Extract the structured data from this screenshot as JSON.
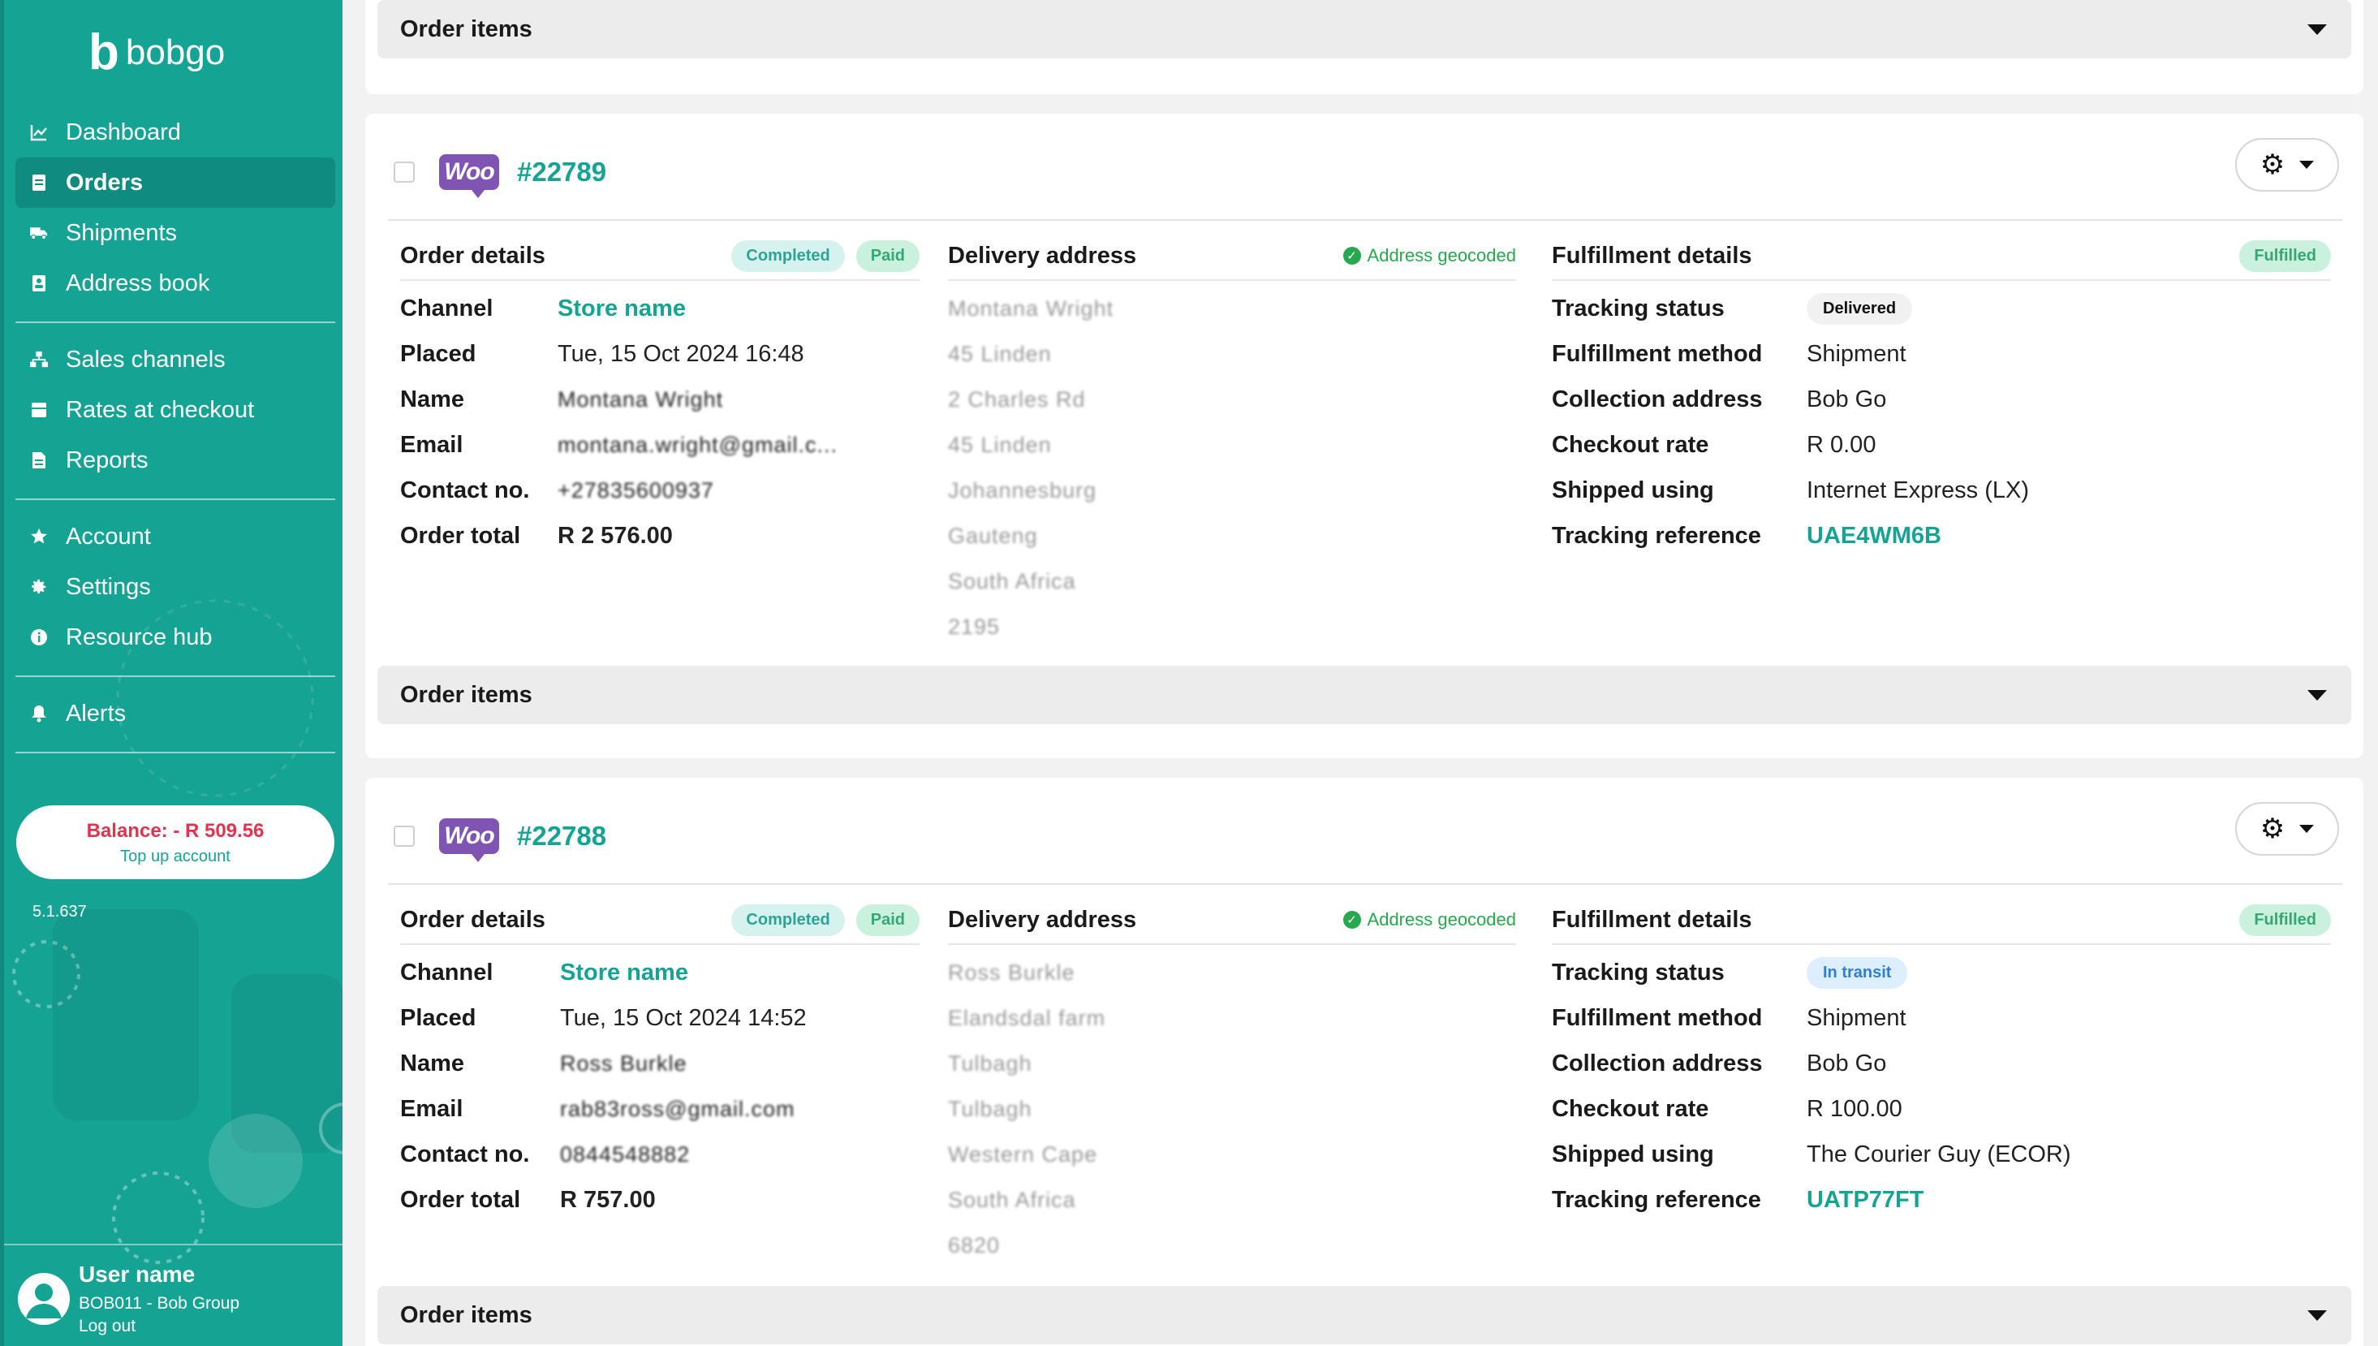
{
  "brand": {
    "logo_mark": "b",
    "logo_text": "bobgo"
  },
  "sidebar": {
    "nav_group1": [
      {
        "label": "Dashboard",
        "icon": "chart-line-icon",
        "active": false
      },
      {
        "label": "Orders",
        "icon": "document-icon",
        "active": true
      },
      {
        "label": "Shipments",
        "icon": "truck-icon",
        "active": false
      },
      {
        "label": "Address book",
        "icon": "address-book-icon",
        "active": false
      }
    ],
    "nav_group2": [
      {
        "label": "Sales channels",
        "icon": "sitemap-icon",
        "active": false
      },
      {
        "label": "Rates at checkout",
        "icon": "cart-icon",
        "active": false
      },
      {
        "label": "Reports",
        "icon": "report-icon",
        "active": false
      }
    ],
    "nav_group3": [
      {
        "label": "Account",
        "icon": "star-icon",
        "active": false
      },
      {
        "label": "Settings",
        "icon": "gear-icon",
        "active": false
      },
      {
        "label": "Resource hub",
        "icon": "info-icon",
        "active": false
      }
    ],
    "nav_group4": [
      {
        "label": "Alerts",
        "icon": "bell-icon",
        "active": false
      }
    ],
    "balance": {
      "amount": "Balance: - R 509.56",
      "link": "Top up account"
    },
    "version": "5.1.637",
    "user": {
      "name": "User name",
      "org": "BOB011 - Bob Group",
      "logout": "Log out"
    }
  },
  "top_items_bar": {
    "label": "Order items"
  },
  "orders": [
    {
      "number": "#22789",
      "channel_logo": "Woo",
      "order_details": {
        "title": "Order details",
        "badges": [
          "Completed",
          "Paid"
        ],
        "rows": [
          {
            "label": "Channel",
            "value": "Store name"
          },
          {
            "label": "Placed",
            "value": "Tue, 15 Oct 2024 16:48"
          },
          {
            "label": "Name",
            "value": "Montana Wright"
          },
          {
            "label": "Email",
            "value": "montana.wright@gmail.c..."
          },
          {
            "label": "Contact no.",
            "value": "+27835600937"
          },
          {
            "label": "Order total",
            "value": "R 2 576.00"
          }
        ]
      },
      "delivery": {
        "title": "Delivery address",
        "geocoded": "Address geocoded",
        "lines": [
          "Montana Wright",
          "45 Linden",
          "2 Charles Rd",
          "45 Linden",
          "Johannesburg",
          "Gauteng",
          "South Africa",
          "2195"
        ]
      },
      "fulfillment": {
        "title": "Fulfillment details",
        "badge": "Fulfilled",
        "tracking_status_label": "Tracking status",
        "tracking_status": "Delivered",
        "rows": [
          {
            "label": "Fulfillment method",
            "value": "Shipment"
          },
          {
            "label": "Collection address",
            "value": "Bob Go"
          },
          {
            "label": "Checkout rate",
            "value": "R 0.00"
          },
          {
            "label": "Shipped using",
            "value": "Internet Express (LX)"
          },
          {
            "label": "Tracking reference",
            "value": "UAE4WM6B"
          }
        ]
      },
      "items_label": "Order items"
    },
    {
      "number": "#22788",
      "channel_logo": "Woo",
      "order_details": {
        "title": "Order details",
        "badges": [
          "Completed",
          "Paid"
        ],
        "rows": [
          {
            "label": "Channel",
            "value": "Store name"
          },
          {
            "label": "Placed",
            "value": "Tue, 15 Oct 2024 14:52"
          },
          {
            "label": "Name",
            "value": "Ross Burkle"
          },
          {
            "label": "Email",
            "value": "rab83ross@gmail.com"
          },
          {
            "label": "Contact no.",
            "value": "0844548882"
          },
          {
            "label": "Order total",
            "value": "R 757.00"
          }
        ]
      },
      "delivery": {
        "title": "Delivery address",
        "geocoded": "Address geocoded",
        "lines": [
          "Ross Burkle",
          "Elandsdal farm",
          "Tulbagh",
          "Tulbagh",
          "Western Cape",
          "South Africa",
          "6820"
        ]
      },
      "fulfillment": {
        "title": "Fulfillment details",
        "badge": "Fulfilled",
        "tracking_status_label": "Tracking status",
        "tracking_status": "In transit",
        "rows": [
          {
            "label": "Fulfillment method",
            "value": "Shipment"
          },
          {
            "label": "Collection address",
            "value": "Bob Go"
          },
          {
            "label": "Checkout rate",
            "value": "R 100.00"
          },
          {
            "label": "Shipped using",
            "value": "The Courier Guy (ECOR)"
          },
          {
            "label": "Tracking reference",
            "value": "UATP77FT"
          }
        ]
      },
      "items_label": "Order items"
    }
  ],
  "colors": {
    "brand": "#15a394",
    "brand_dark": "#0f8c7f",
    "woo": "#7f54b3",
    "danger": "#e1334d"
  }
}
